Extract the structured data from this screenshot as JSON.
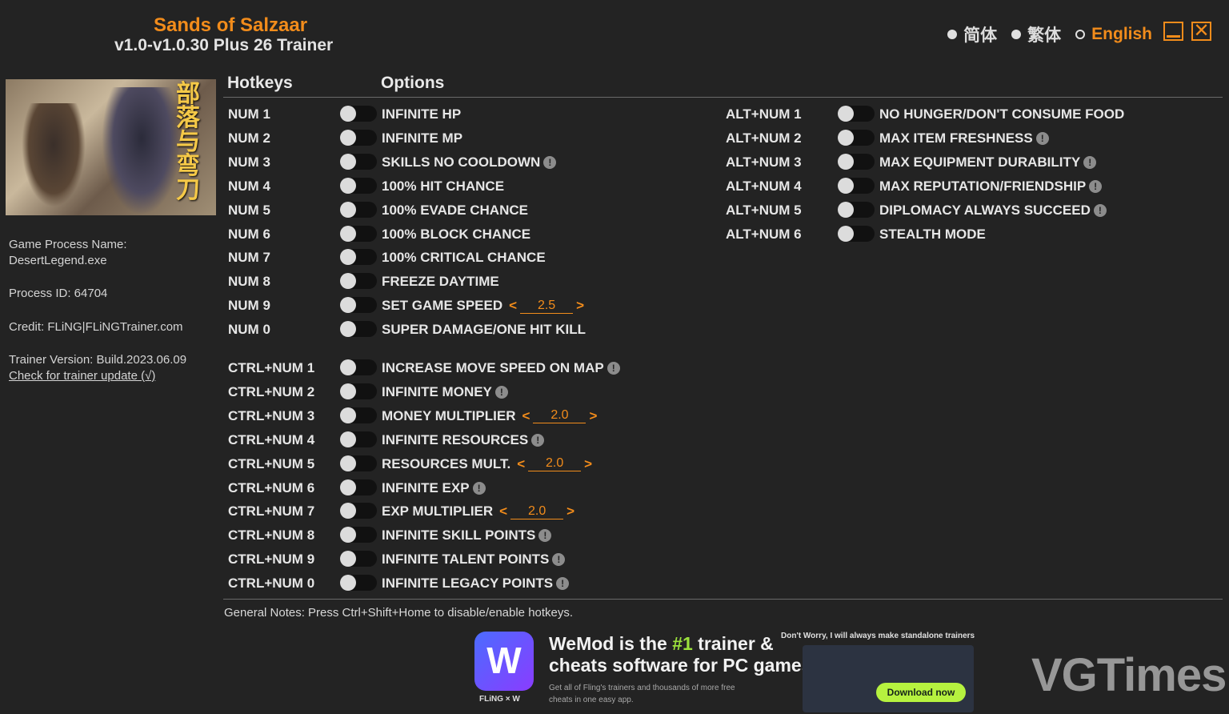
{
  "header": {
    "game_title": "Sands of Salzaar",
    "trainer_title": "v1.0-v1.0.30 Plus 26 Trainer"
  },
  "languages": [
    {
      "label": "简体",
      "selected": false
    },
    {
      "label": "繁体",
      "selected": false
    },
    {
      "label": "English",
      "selected": true
    }
  ],
  "window": {
    "minimize": "minimize",
    "close": "✕"
  },
  "sidebar": {
    "cover_calligraphy": "部落与弯刀",
    "process_name_label": "Game Process Name:",
    "process_name": "DesertLegend.exe",
    "process_id": "Process ID: 64704",
    "credit": "Credit: FLiNG|FLiNGTrainer.com",
    "version": "Trainer Version: Build.2023.06.09",
    "update_link": "Check for trainer update (√)"
  },
  "columns": {
    "hotkeys": "Hotkeys",
    "options": "Options"
  },
  "options_left": [
    {
      "hotkey": "NUM 1",
      "label": "INFINITE HP"
    },
    {
      "hotkey": "NUM 2",
      "label": "INFINITE MP"
    },
    {
      "hotkey": "NUM 3",
      "label": "SKILLS NO COOLDOWN",
      "info": "!"
    },
    {
      "hotkey": "NUM 4",
      "label": "100% HIT CHANCE"
    },
    {
      "hotkey": "NUM 5",
      "label": "100% EVADE CHANCE"
    },
    {
      "hotkey": "NUM 6",
      "label": "100% BLOCK CHANCE"
    },
    {
      "hotkey": "NUM 7",
      "label": "100% CRITICAL CHANCE"
    },
    {
      "hotkey": "NUM 8",
      "label": "FREEZE DAYTIME"
    },
    {
      "hotkey": "NUM 9",
      "label": "SET GAME SPEED",
      "value": "2.5"
    },
    {
      "hotkey": "NUM 0",
      "label": "SUPER DAMAGE/ONE HIT KILL"
    }
  ],
  "options_ctrl": [
    {
      "hotkey": "CTRL+NUM 1",
      "label": "INCREASE MOVE SPEED ON MAP",
      "info": "!"
    },
    {
      "hotkey": "CTRL+NUM 2",
      "label": "INFINITE MONEY",
      "info": "!"
    },
    {
      "hotkey": "CTRL+NUM 3",
      "label": "MONEY MULTIPLIER",
      "value": "2.0"
    },
    {
      "hotkey": "CTRL+NUM 4",
      "label": "INFINITE RESOURCES",
      "info": "!"
    },
    {
      "hotkey": "CTRL+NUM 5",
      "label": "RESOURCES MULT.",
      "value": "2.0"
    },
    {
      "hotkey": "CTRL+NUM 6",
      "label": "INFINITE EXP",
      "info": "!"
    },
    {
      "hotkey": "CTRL+NUM 7",
      "label": "EXP MULTIPLIER",
      "value": "2.0"
    },
    {
      "hotkey": "CTRL+NUM 8",
      "label": "INFINITE SKILL POINTS",
      "info": "!"
    },
    {
      "hotkey": "CTRL+NUM 9",
      "label": "INFINITE TALENT POINTS",
      "info": "!"
    },
    {
      "hotkey": "CTRL+NUM 0",
      "label": "INFINITE LEGACY POINTS",
      "info": "!"
    }
  ],
  "options_alt": [
    {
      "hotkey": "ALT+NUM 1",
      "label": "NO HUNGER/DON'T CONSUME FOOD"
    },
    {
      "hotkey": "ALT+NUM 2",
      "label": "MAX ITEM FRESHNESS",
      "info": "!"
    },
    {
      "hotkey": "ALT+NUM 3",
      "label": "MAX EQUIPMENT DURABILITY",
      "info": "!"
    },
    {
      "hotkey": "ALT+NUM 4",
      "label": "MAX REPUTATION/FRIENDSHIP",
      "info": "!"
    },
    {
      "hotkey": "ALT+NUM 5",
      "label": "DIPLOMACY ALWAYS SUCCEED",
      "info": "!"
    },
    {
      "hotkey": "ALT+NUM 6",
      "label": "STEALTH MODE"
    }
  ],
  "spin_arrows": {
    "left": "<",
    "right": ">"
  },
  "notes": "General Notes: Press Ctrl+Shift+Home to disable/enable hotkeys.",
  "ad": {
    "logo": "W",
    "brand": "FLiNG × W",
    "headline_a": "WeMod is the ",
    "headline_b": "#1",
    "headline_c": " trainer &",
    "headline_d": "cheats software for PC games",
    "sub": "Get all of Fling's trainers and thousands of more free cheats in one easy app.",
    "worry": "Don't Worry, I will always make standalone trainers",
    "download": "Download now"
  },
  "watermark": "VGTimes",
  "colors": {
    "accent": "#f28c1b",
    "background": "#232323",
    "toggle_track": "#111111",
    "ad_button": "#b6f23f"
  }
}
